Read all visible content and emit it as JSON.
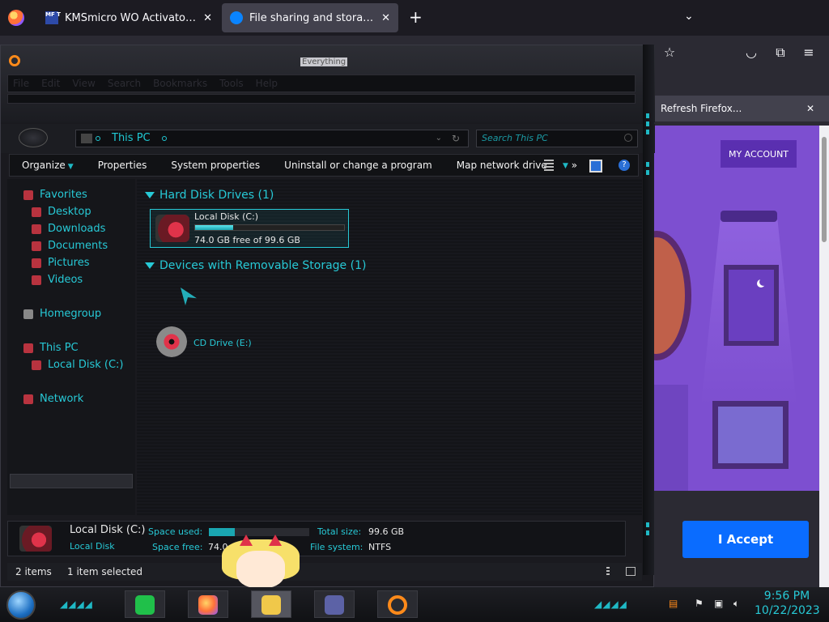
{
  "browser": {
    "tabs": [
      {
        "favicon": "MF T",
        "title": "KMSmicro WO Activator for offi",
        "close": "✕"
      },
      {
        "favicon": "",
        "title": "File sharing and storage made s",
        "close": "✕"
      }
    ],
    "new_tab": "+",
    "tab_list": "⌄",
    "toolbar_icons": [
      "star-icon",
      "pocket-icon",
      "extensions-icon",
      "menu-icon"
    ],
    "notification": {
      "text": "Refresh Firefox...",
      "close": "✕"
    }
  },
  "webpage": {
    "account_button": "MY ACCOUNT",
    "accept_button": "I Accept",
    "colors": {
      "bg": "#7d4fd0",
      "accept": "#0a6cff"
    }
  },
  "explorer": {
    "title": "Everything",
    "menu": [
      "File",
      "Edit",
      "View",
      "Search",
      "Bookmarks",
      "Tools",
      "Help"
    ],
    "address": "This PC",
    "search_placeholder": "Search This PC",
    "commands": [
      "Organize",
      "Properties",
      "System properties",
      "Uninstall or change a program",
      "Map network drive",
      "»"
    ],
    "nav": {
      "favorites": "Favorites",
      "desktop": "Desktop",
      "downloads": "Downloads",
      "documents": "Documents",
      "pictures": "Pictures",
      "videos": "Videos",
      "homegroup": "Homegroup",
      "this_pc": "This PC",
      "local_disk": "Local Disk (C:)",
      "network": "Network"
    },
    "groups": {
      "hdd": "Hard Disk Drives (1)",
      "removable": "Devices with Removable Storage (1)"
    },
    "drive": {
      "name": "Local Disk (C:)",
      "free_text": "74.0 GB free of 99.6 GB",
      "used_fraction": 0.257
    },
    "cd": {
      "name": "CD Drive (E:)"
    },
    "details": {
      "title": "Local Disk (C:)",
      "subtitle": "Local Disk",
      "space_used_label": "Space used:",
      "space_free_label": "Space free:",
      "space_free_value": "74.0 G",
      "total_size_label": "Total size:",
      "total_size_value": "99.6 GB",
      "fs_label": "File system:",
      "fs_value": "NTFS"
    },
    "status": {
      "items": "2 items",
      "selected": "1 item selected"
    },
    "accent": "#27c9d6"
  },
  "taskbar": {
    "time": "9:56 PM",
    "date": "10/22/2023",
    "apps": [
      "notes-icon",
      "firefox-icon",
      "file-explorer-icon",
      "card-icon",
      "search-icon"
    ]
  }
}
